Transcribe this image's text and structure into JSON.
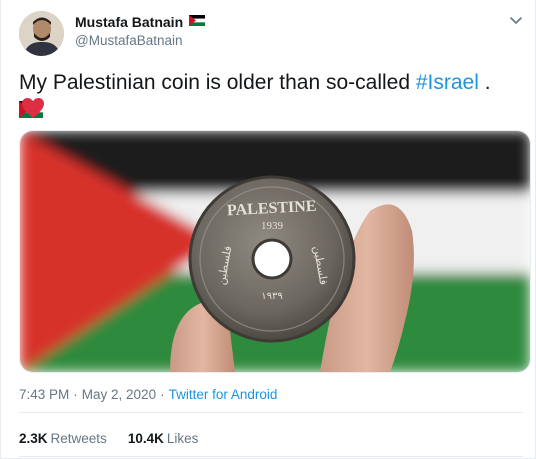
{
  "tweet": {
    "author": {
      "display_name": "Mustafa Batnain",
      "handle": "@MustafaBatnain",
      "flag_icon": "palestine-flag-icon"
    },
    "text": {
      "main": "My Palestinian coin is older than so-called ",
      "hashtag": "#Israel",
      "suffix": " .",
      "end_emojis": [
        "palestine-flag-icon",
        "red-heart-icon"
      ]
    },
    "menu_icon": "chevron-down-icon",
    "media": {
      "description_icon": "photo",
      "coin": {
        "top_text": "PALESTINE",
        "year": "1939",
        "arabic_left": "فلسطين",
        "arabic_right": "فلسطين",
        "hebrew_year": "١٩٣٩"
      }
    },
    "meta": {
      "time": "7:43 PM",
      "separator": " · ",
      "date": "May 2, 2020",
      "separator2": " · ",
      "app": "Twitter for Android"
    },
    "stats": {
      "retweets": {
        "count": "2.3K",
        "label": "Retweets"
      },
      "likes": {
        "count": "10.4K",
        "label": "Likes"
      }
    },
    "colors": {
      "link": "#1b95e0",
      "secondary": "#657786",
      "text": "#14171a",
      "flag_red": "#ce1126",
      "flag_green": "#007a3d"
    }
  }
}
